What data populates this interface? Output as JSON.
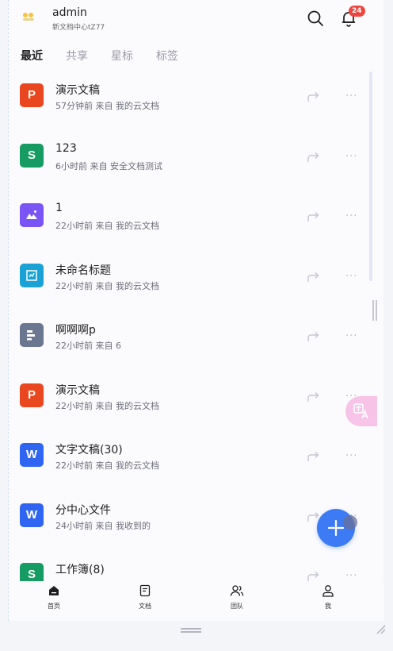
{
  "header": {
    "username": "admin",
    "org_name": "新文档中心tZ77",
    "notification_count": "24"
  },
  "tabs": [
    {
      "label": "最近",
      "active": true
    },
    {
      "label": "共享",
      "active": false
    },
    {
      "label": "星标",
      "active": false
    },
    {
      "label": "标签",
      "active": false
    }
  ],
  "files": [
    {
      "name": "演示文稿",
      "meta": "57分钟前 来自 我的云文档",
      "type": "presentation",
      "letter": "P",
      "color": "#e8471f"
    },
    {
      "name": "123",
      "meta": "6小时前 来自 安全文档测试",
      "type": "spreadsheet",
      "letter": "S",
      "color": "#169b62"
    },
    {
      "name": "1",
      "meta": "22小时前 来自 我的云文档",
      "type": "image",
      "letter": "",
      "color": "#7a54f5"
    },
    {
      "name": "未命名标题",
      "meta": "22小时前 来自 我的云文档",
      "type": "form",
      "letter": "",
      "color": "#1aa2d6"
    },
    {
      "name": "啊啊啊p",
      "meta": "22小时前 来自 6",
      "type": "flowchart",
      "letter": "",
      "color": "#6b7690"
    },
    {
      "name": "演示文稿",
      "meta": "22小时前 来自 我的云文档",
      "type": "presentation",
      "letter": "P",
      "color": "#e8471f"
    },
    {
      "name": "文字文稿(30)",
      "meta": "22小时前 来自 我的云文档",
      "type": "document",
      "letter": "W",
      "color": "#2f65f0"
    },
    {
      "name": "分中心文件",
      "meta": "24小时前 来自 我收到的",
      "type": "document",
      "letter": "W",
      "color": "#2f65f0"
    },
    {
      "name": "工作簿(8)",
      "meta": "",
      "type": "spreadsheet",
      "letter": "S",
      "color": "#169b62"
    }
  ],
  "more_label": "···",
  "bottom_nav": [
    {
      "label": "首页",
      "icon": "home-icon",
      "active": true
    },
    {
      "label": "文档",
      "icon": "document-icon",
      "active": false
    },
    {
      "label": "团队",
      "icon": "team-icon",
      "active": false
    },
    {
      "label": "我",
      "icon": "profile-icon",
      "active": false
    }
  ],
  "colors": {
    "accent": "#3d7bf5",
    "badge": "#f0453e",
    "translate_button": "#f7c4e8"
  }
}
